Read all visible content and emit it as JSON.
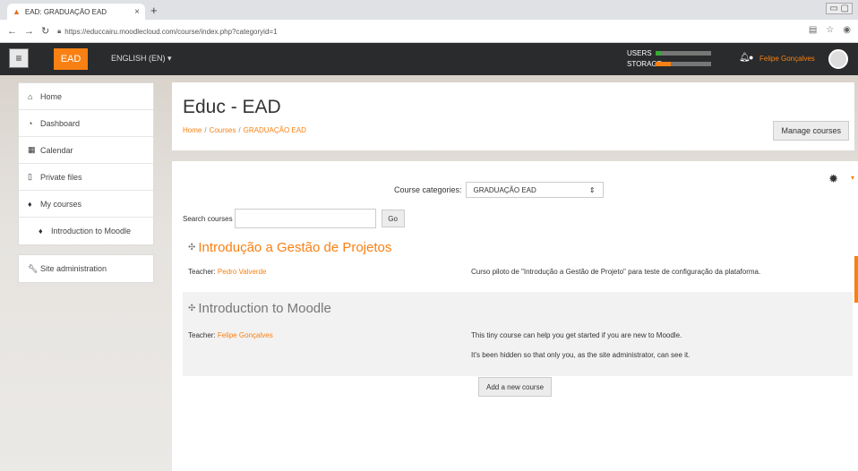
{
  "browser": {
    "tab_title": "EAD: GRADUAÇÃO EAD",
    "tab_close": "×",
    "new_tab": "+",
    "url": "https://educcairu.moodlecloud.com/course/index.php?categoryid=1"
  },
  "navbar": {
    "brand": "EAD",
    "language": "ENGLISH (EN) ▾",
    "users_label": "USERS",
    "storage_label": "STORAGE",
    "users_fraction": 0.1,
    "storage_fraction": 0.27,
    "users_color": "#3aaa35",
    "storage_color": "#f98012",
    "user_name": "Felipe Gonçalves"
  },
  "sidebar": {
    "items": [
      {
        "label": "Home",
        "icon": "home-icon"
      },
      {
        "label": "Dashboard",
        "icon": "dashboard-icon"
      },
      {
        "label": "Calendar",
        "icon": "calendar-icon"
      },
      {
        "label": "Private files",
        "icon": "file-icon"
      },
      {
        "label": "My courses",
        "icon": "graduation-cap-icon"
      },
      {
        "label": "Introduction to Moodle",
        "icon": "graduation-cap-icon"
      }
    ],
    "admin_label": "Site administration"
  },
  "header": {
    "title": "Educ - EAD",
    "breadcrumb": [
      "Home",
      "Courses",
      "GRADUAÇÃO EAD"
    ],
    "manage_button": "Manage courses"
  },
  "main": {
    "category_label": "Course categories:",
    "category_value": "GRADUAÇÃO EAD",
    "search_label": "Search courses",
    "search_value": "",
    "go_button": "Go",
    "teacher_label": "Teacher:",
    "courses": [
      {
        "name": "Introdução a Gestão de Projetos",
        "teacher": "Pedro Valverde",
        "summary": [
          "Curso piloto de \"Introdução a Gestão de Projeto\" para teste de configuração da plataforma."
        ]
      },
      {
        "name": "Introduction to Moodle",
        "teacher": "Felipe Gonçalves",
        "summary": [
          "This tiny course can help you get started if you are new to Moodle.",
          "It's been hidden so that only you, as the site administrator, can see it."
        ]
      }
    ],
    "add_button": "Add a new course"
  },
  "colors": {
    "accent": "#f98012",
    "navbar_bg": "#292b2c"
  }
}
